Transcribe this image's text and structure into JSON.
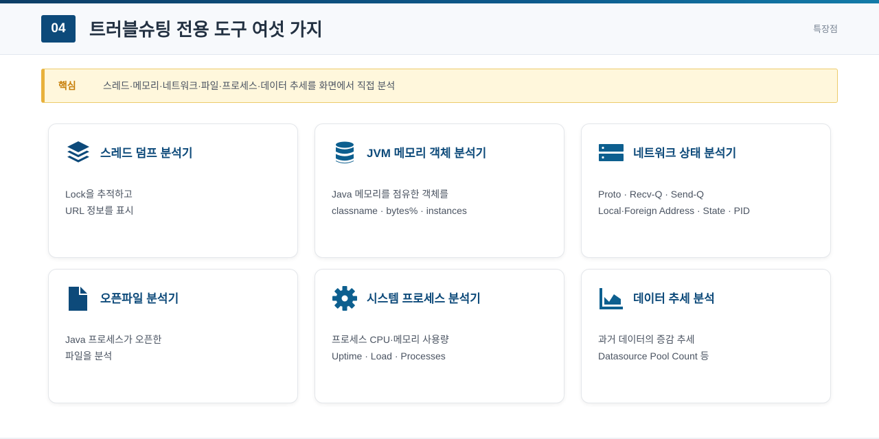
{
  "header": {
    "badge": "04",
    "title": "트러블슈팅 전용 도구 여섯 가지",
    "right_label": "특장점"
  },
  "callout": {
    "key": "핵심",
    "text": "스레드·메모리·네트워크·파일·프로세스·데이터 추세를 화면에서 직접 분석"
  },
  "colors": {
    "brand": "#0d4a7a",
    "accent": "#e8b13c"
  },
  "cards": [
    {
      "icon": "layers-icon",
      "title": "스레드 덤프 분석기",
      "line1": "Lock을 추적하고",
      "line2": "URL 정보를 표시"
    },
    {
      "icon": "database-icon",
      "title": "JVM 메모리 객체 분석기",
      "line1": "Java 메모리를 점유한 객체를",
      "line2": "classname · bytes% · instances"
    },
    {
      "icon": "server-icon",
      "title": "네트워크 상태 분석기",
      "line1": "Proto · Recv-Q · Send-Q",
      "line2": "Local·Foreign Address · State · PID"
    },
    {
      "icon": "file-icon",
      "title": "오픈파일 분석기",
      "line1": "Java 프로세스가 오픈한",
      "line2": "파일을 분석"
    },
    {
      "icon": "gear-icon",
      "title": "시스템 프로세스 분석기",
      "line1": "프로세스 CPU·메모리 사용량",
      "line2": "Uptime · Load · Processes"
    },
    {
      "icon": "area-chart-icon",
      "title": "데이터 추세 분석",
      "line1": "과거 데이터의 증감 추세",
      "line2": "Datasource Pool Count 등"
    }
  ]
}
